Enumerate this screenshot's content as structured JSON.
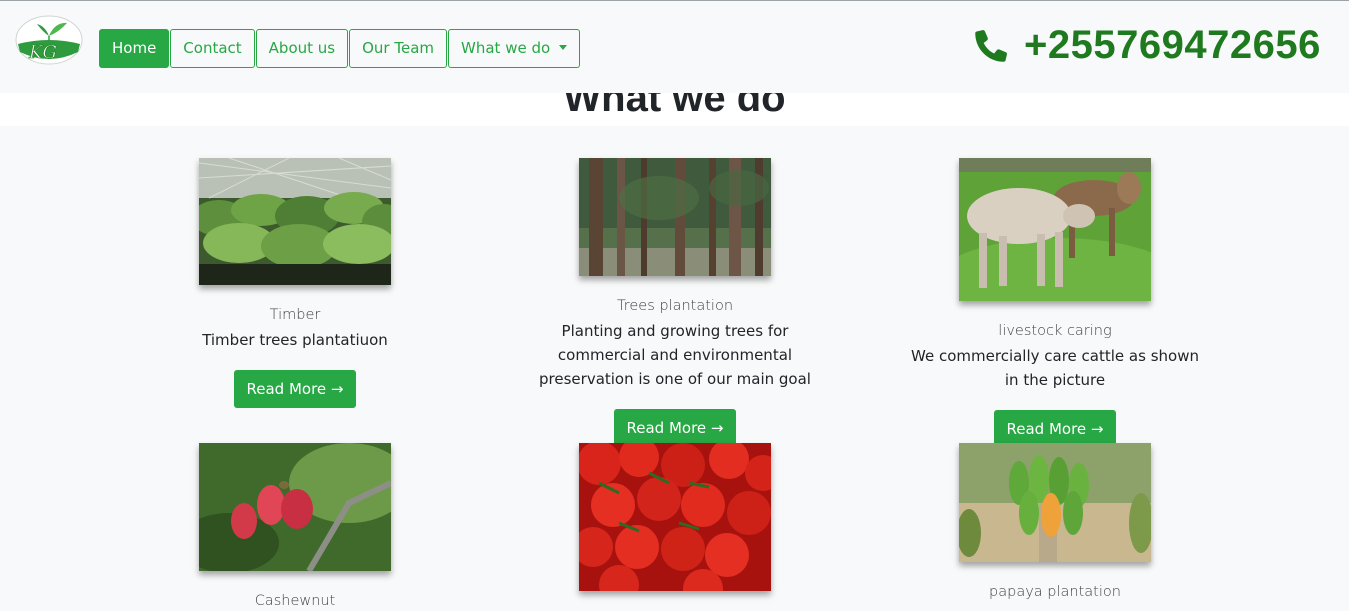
{
  "brand": {
    "logo_icon": "kg-leaf-logo"
  },
  "nav": {
    "items": [
      {
        "label": "Home",
        "active": true
      },
      {
        "label": "Contact"
      },
      {
        "label": "About us"
      },
      {
        "label": "Our Team"
      },
      {
        "label": "What we do",
        "dropdown": true
      }
    ]
  },
  "contact": {
    "phone_icon": "phone-icon",
    "phone": "+255769472656"
  },
  "section": {
    "title": "What we do"
  },
  "cards": [
    {
      "title": "Timber",
      "text": "Timber trees plantatiuon",
      "button": "Read More →",
      "image": "seedlings-nursery"
    },
    {
      "title": "Trees plantation",
      "text": "Planting and growing trees for commercial and environmental preservation is one of our main goal",
      "button": "Read More →",
      "image": "forest-trees"
    },
    {
      "title": "livestock caring",
      "text": "We commercially care cattle as shown in the picture",
      "button": "Read More →",
      "image": "cattle"
    },
    {
      "title": "Cashewnut",
      "image": "cashew-fruit"
    },
    {
      "image": "tomatoes"
    },
    {
      "title": "papaya plantation",
      "image": "papaya-tree"
    }
  ],
  "colors": {
    "brand_green": "#28a745",
    "phone_green": "#1f7a1f",
    "background": "#f8f9fa"
  }
}
